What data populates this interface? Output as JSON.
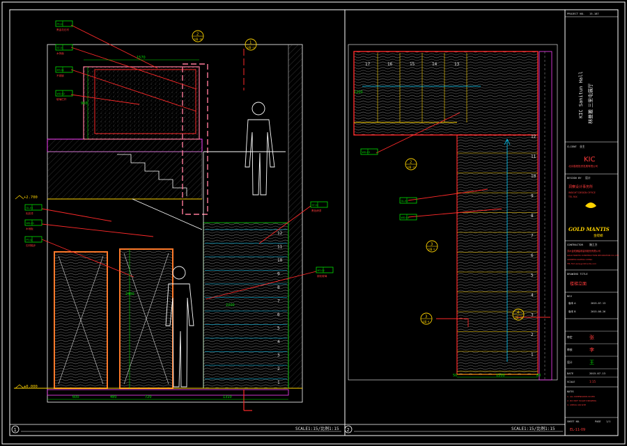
{
  "drawing": {
    "views": [
      {
        "number": "1",
        "scale": "SCALE1:15/比例1:15"
      },
      {
        "number": "2",
        "scale": "SCALE1:15/比例1:15"
      }
    ],
    "left_levels": [
      "+2.700",
      "±0.000"
    ],
    "left_dims_bottom": [
      "600",
      "480",
      "720",
      "1310"
    ],
    "left_dims_top": [
      "1570",
      "1570"
    ],
    "left_dims_side": [
      "900",
      "2400",
      "2200"
    ],
    "right_dims_bottom": [
      "50",
      "1200",
      "80"
    ],
    "right_dims_side": [
      "1200"
    ],
    "left_steps": [
      "12",
      "11",
      "10",
      "9",
      "8",
      "7",
      "6",
      "5",
      "4",
      "3",
      "2",
      "1"
    ],
    "right_top_steps": [
      "17",
      "16",
      "15",
      "14",
      "13"
    ],
    "right_steps": [
      "12",
      "11",
      "10",
      "9",
      "8",
      "7",
      "6",
      "5",
      "4",
      "3",
      "2",
      "1"
    ],
    "bubbles": [
      {
        "num": "2",
        "ref": "立面-10"
      },
      {
        "num": "1",
        "ref": "立面-11"
      },
      {
        "num": "2",
        "ref": "立面-12"
      },
      {
        "num": "3",
        "ref": "立面-8"
      },
      {
        "num": "3",
        "ref": "立面-9"
      },
      {
        "num": "4",
        "ref": "立面-10"
      }
    ],
    "callout_codes": [
      "PT-01",
      "ST-01",
      "MT-01",
      "WD-02",
      "GL-01",
      "WD-01",
      "PT-02",
      "ST-02",
      "MT-02",
      "WD-03",
      "GL-02",
      "WD-04"
    ],
    "callout_notes": [
      "黑金花石材",
      "木饰面",
      "不锈钢",
      "玻璃栏杆",
      "乳胶漆",
      "木地板",
      "石材踏步",
      "黑色烤漆",
      "钢化玻璃",
      "石材"
    ]
  },
  "title_block": {
    "project_label": "PROJECT NO.",
    "project_no": "15-187",
    "project_name_en": "KIC Sanitun Hall",
    "project_name_cn": "林曼搬 三里屯展厅",
    "client_label": "CLIENT",
    "client": "业主",
    "client_logo": "KIC",
    "client_sub": "北京嘉程投资发展有限公司",
    "designer_label": "DESIGN BY",
    "designer": "设计",
    "designer_firm": "洞察设计事务所",
    "designer_address": "INSIGHT DESIGN OFFICE",
    "designer_address2": "TEL  FAX",
    "brand": "GOLD MANTIS",
    "brand_cn": "金螳螂",
    "contractor_label": "CONTRACTOR",
    "contractor": "施工方",
    "contractor_lines": [
      "苏州金螳螂建筑装饰股份有限公司",
      "GOLD MANTIS CONSTRUCTION DECORATION CO.,LTD",
      "ADDRESS  SUZHOU CHINA",
      "TEL  FAX  www.goldmantis.com"
    ],
    "drawing_title_label": "DRAWING TITLE",
    "drawing_title": "楼梯立面",
    "revision_label": "REV",
    "revisions": [
      {
        "label": "版本 A",
        "date": "2015.07.13"
      },
      {
        "label": "版本 B",
        "date": "2015.08.26"
      }
    ],
    "signatures": [
      {
        "role": "审定",
        "name": "张",
        "color": "#ff3b3b"
      },
      {
        "role": "审核",
        "name": "李",
        "color": "#ff3b3b"
      },
      {
        "role": "设计",
        "name": "王",
        "color": "#00e000"
      }
    ],
    "date_label": "DATE",
    "date": "2015.07.13",
    "scale_label": "SCALE",
    "scale": "1:15",
    "notes": [
      "NOTES",
      "1. ALL DIMENSIONS IN MM",
      "2. DO NOT SCALE DRAWING",
      "3. CHECK ON SITE"
    ],
    "sheet_label": "SHEET NO.",
    "sheet_no": "EL-11-09",
    "page_label": "PAGE",
    "page_no": "1/1"
  },
  "colors": {
    "background": "#000000",
    "frame": "#ffffff",
    "red": "#ff2a2a",
    "green": "#00e000",
    "yellow": "#ffd400",
    "magenta": "#ff40ff",
    "cyan": "#00d0ff",
    "pink": "#ff7a9a",
    "wood": "#b4b4b4"
  }
}
